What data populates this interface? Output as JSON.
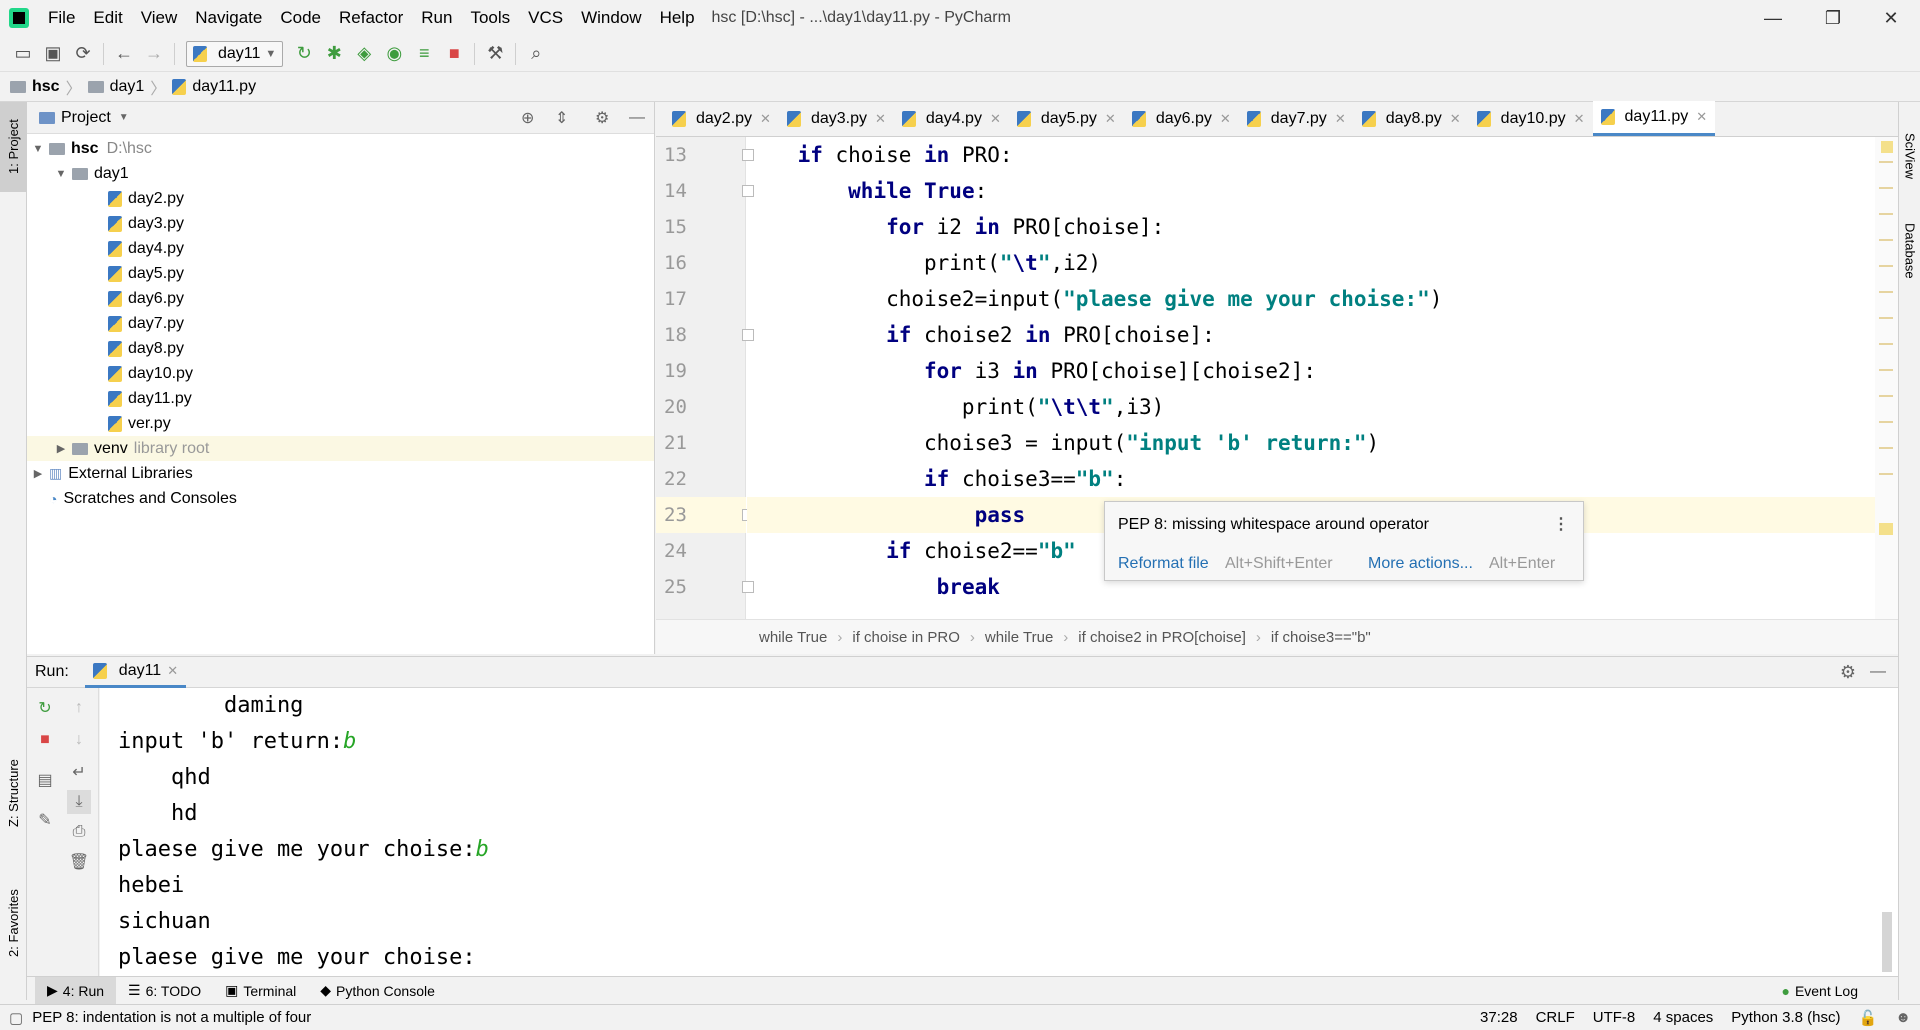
{
  "titlebar": {
    "menus": [
      "File",
      "Edit",
      "View",
      "Navigate",
      "Code",
      "Refactor",
      "Run",
      "Tools",
      "VCS",
      "Window",
      "Help"
    ],
    "window_title": "hsc [D:\\hsc] - ...\\day1\\day11.py - PyCharm",
    "minimize": "—",
    "restore": "❐",
    "close": "✕"
  },
  "toolbar": {
    "run_config": "day11"
  },
  "navbar": {
    "project": "hsc",
    "folder": "day1",
    "file": "day11.py"
  },
  "left_strip": {
    "project_tab": "1: Project",
    "structure_tab": "Z: Structure",
    "favorites_tab": "2: Favorites"
  },
  "right_strip": {
    "sciview_tab": "SciView",
    "database_tab": "Database"
  },
  "project_panel": {
    "title": "Project",
    "root_name": "hsc",
    "root_path": "D:\\hsc",
    "folder": "day1",
    "files": [
      "day2.py",
      "day3.py",
      "day4.py",
      "day5.py",
      "day6.py",
      "day7.py",
      "day8.py",
      "day10.py",
      "day11.py",
      "ver.py"
    ],
    "venv": "venv",
    "venv_note": "library root",
    "external": "External Libraries",
    "scratches": "Scratches and Consoles"
  },
  "editor": {
    "tabs": [
      "day2.py",
      "day3.py",
      "day4.py",
      "day5.py",
      "day6.py",
      "day7.py",
      "day8.py",
      "day10.py",
      "day11.py"
    ],
    "active_tab": "day11.py",
    "line_numbers": [
      "13",
      "14",
      "15",
      "16",
      "17",
      "18",
      "19",
      "20",
      "21",
      "22",
      "23",
      "24",
      "25"
    ],
    "breadcrumb": [
      "while True",
      "if choise in PRO",
      "while True",
      "if choise2 in PRO[choise]",
      "if choise3==\"b\""
    ]
  },
  "tooltip": {
    "message": "PEP 8: missing whitespace around operator",
    "action1": "Reformat file",
    "shortcut1": "Alt+Shift+Enter",
    "action2": "More actions...",
    "shortcut2": "Alt+Enter"
  },
  "run_panel": {
    "label": "Run:",
    "tab": "day11",
    "console": [
      {
        "text": "        daming",
        "input": ""
      },
      {
        "text": "input 'b' return:",
        "input": "b"
      },
      {
        "text": "    qhd",
        "input": ""
      },
      {
        "text": "    hd",
        "input": ""
      },
      {
        "text": "plaese give me your choise:",
        "input": "b"
      },
      {
        "text": "hebei",
        "input": ""
      },
      {
        "text": "sichuan",
        "input": ""
      },
      {
        "text": "plaese give me your choise:",
        "input": ""
      }
    ]
  },
  "bottom_tabs": {
    "run": "4: Run",
    "todo": "6: TODO",
    "terminal": "Terminal",
    "python_console": "Python Console",
    "event_log": "Event Log"
  },
  "statusbar": {
    "message": "PEP 8: indentation is not a multiple of four",
    "position": "37:28",
    "line_sep": "CRLF",
    "encoding": "UTF-8",
    "indent": "4 spaces",
    "interpreter": "Python 3.8 (hsc)"
  },
  "colors": {
    "keyword": "#000080",
    "string": "#008080",
    "current_line": "#fffae3",
    "user_input": "#26a526",
    "accent": "#4a88c7"
  }
}
